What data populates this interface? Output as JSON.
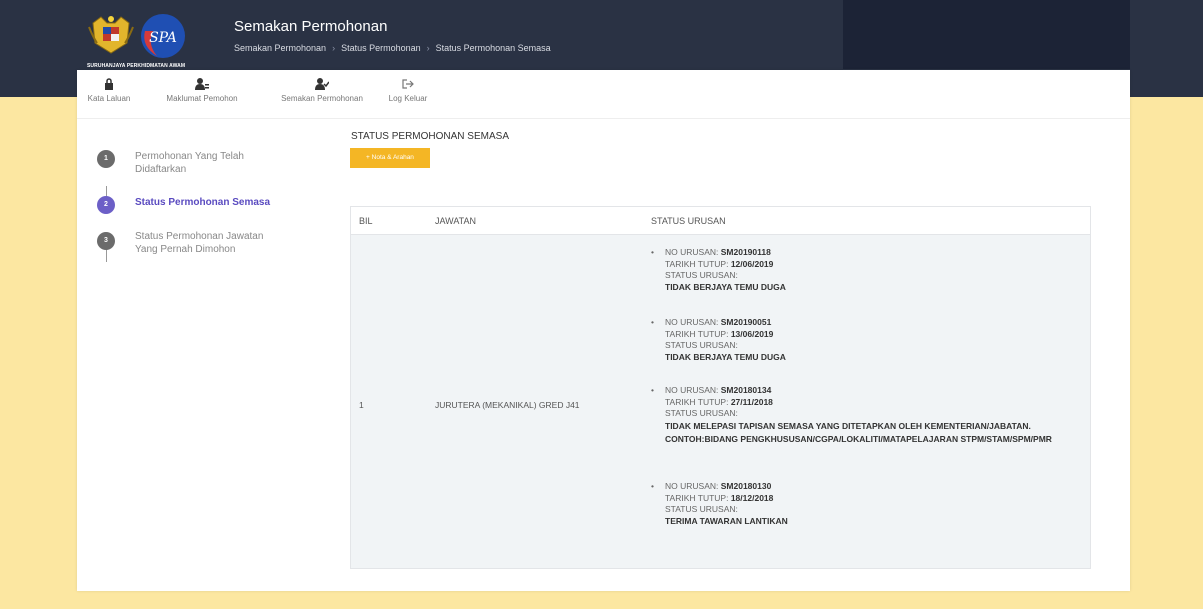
{
  "header": {
    "logo_text": "SURUHANJAYA PERKHIDMATAN AWAM",
    "title": "Semakan Permohonan",
    "breadcrumb": [
      "Semakan Permohonan",
      "Status Permohonan",
      "Status Permohonan Semasa"
    ],
    "band_color": "#2a3244",
    "accent_color": "#f4b625"
  },
  "tabs": [
    {
      "label": "Kata Laluan",
      "icon": "lock-icon"
    },
    {
      "label": "Maklumat Pemohon",
      "icon": "user-info-icon"
    },
    {
      "label": "Semakan Permohonan",
      "icon": "user-check-icon"
    },
    {
      "label": "Log Keluar",
      "icon": "sign-out-icon"
    }
  ],
  "steps": [
    {
      "num": "1",
      "label": "Permohonan Yang Telah Didaftarkan"
    },
    {
      "num": "2",
      "label": "Status Permohonan Semasa"
    },
    {
      "num": "3",
      "label": "Status Permohonan Jawatan Yang Pernah Dimohon"
    }
  ],
  "main": {
    "title": "STATUS PERMOHONAN SEMASA",
    "nota_button": "+ Nota & Arahan"
  },
  "table": {
    "headers": [
      "BIL",
      "JAWATAN",
      "STATUS URUSAN"
    ],
    "row": {
      "bil": "1",
      "jawatan": "JURUTERA (MEKANIKAL) GRED J41"
    },
    "labels": {
      "no_urusan": "NO URUSAN:",
      "tarikh_tutup": "TARIKH TUTUP:",
      "status_urusan": "STATUS URUSAN:"
    },
    "entries": [
      {
        "no": "SM20190118",
        "tarikh": "12/06/2019",
        "status": "TIDAK BERJAYA TEMU DUGA"
      },
      {
        "no": "SM20190051",
        "tarikh": "13/06/2019",
        "status": "TIDAK BERJAYA TEMU DUGA"
      },
      {
        "no": "SM20180134",
        "tarikh": "27/11/2018",
        "status": "TIDAK MELEPASI TAPISAN SEMASA YANG DITETAPKAN OLEH KEMENTERIAN/JABATAN. CONTOH:BIDANG PENGKHUSUSAN/CGPA/LOKALITI/MATAPELAJARAN STPM/STAM/SPM/PMR"
      },
      {
        "no": "SM20180130",
        "tarikh": "18/12/2018",
        "status": "TERIMA TAWARAN LANTIKAN"
      }
    ]
  }
}
